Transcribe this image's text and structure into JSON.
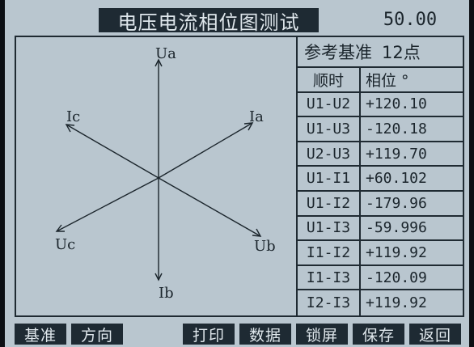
{
  "header": {
    "title": "电压电流相位图测试",
    "frequency": "50.00"
  },
  "phasor_diagram": {
    "labels": {
      "ua": "Ua",
      "ub": "Ub",
      "uc": "Uc",
      "ia": "Ia",
      "ib": "Ib",
      "ic": "Ic"
    }
  },
  "table": {
    "reference_label": "参考基准",
    "reference_value": "12点",
    "columns": [
      "顺时",
      "相位 °"
    ],
    "rows": [
      {
        "pair": "U1-U2",
        "value": "+120.10"
      },
      {
        "pair": "U1-U3",
        "value": "-120.18"
      },
      {
        "pair": "U2-U3",
        "value": "+119.70"
      },
      {
        "pair": "U1-I1",
        "value": "+60.102"
      },
      {
        "pair": "U1-I2",
        "value": "-179.96"
      },
      {
        "pair": "U1-I3",
        "value": "-59.996"
      },
      {
        "pair": "I1-I2",
        "value": "+119.92"
      },
      {
        "pair": "I1-I3",
        "value": "-120.09"
      },
      {
        "pair": "I2-I3",
        "value": "+119.92"
      }
    ]
  },
  "softkeys": {
    "reference": "基准",
    "direction": "方向",
    "print": "打印",
    "data": "数据",
    "lock_screen": "锁屏",
    "save": "保存",
    "back": "返回"
  }
}
